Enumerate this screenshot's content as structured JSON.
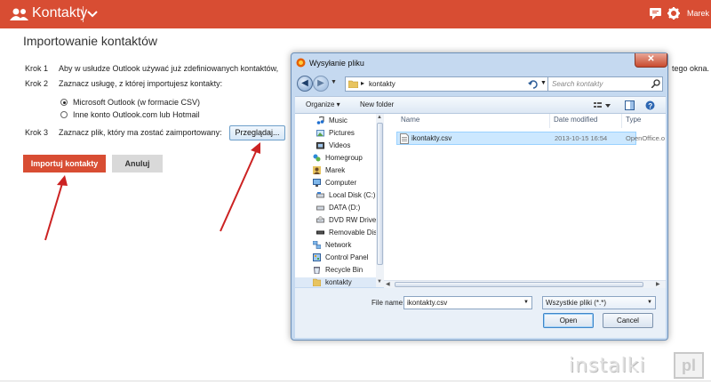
{
  "header": {
    "app_title": "Kontakty",
    "user_name": "Marek"
  },
  "page": {
    "title": "Importowanie kontaktów",
    "step1_label": "Krok 1",
    "step1_text": "Aby w usłudze Outlook używać już zdefiniowanych kontaktów,",
    "step1_tail": "tego okna.",
    "step2_label": "Krok 2",
    "step2_text": "Zaznacz usługę, z której importujesz kontakty:",
    "options": [
      {
        "label": "Microsoft Outlook (w formacie CSV)",
        "selected": true
      },
      {
        "label": "Inne konto Outlook.com lub Hotmail",
        "selected": false
      }
    ],
    "step3_label": "Krok 3",
    "step3_text": "Zaznacz plik, który ma zostać zaimportowany:",
    "browse_label": "Przeglądaj...",
    "import_label": "Importuj kontakty",
    "cancel_label": "Anuluj"
  },
  "dialog": {
    "title": "Wysyłanie pliku",
    "breadcrumb": "kontakty",
    "search_placeholder": "Search kontakty",
    "organize_label": "Organize ▾",
    "new_folder_label": "New folder",
    "nav_items": [
      {
        "label": "Music",
        "icon": "music-icon"
      },
      {
        "label": "Pictures",
        "icon": "pictures-icon"
      },
      {
        "label": "Videos",
        "icon": "videos-icon"
      },
      {
        "label": "Homegroup",
        "icon": "homegroup-icon"
      },
      {
        "label": "Marek",
        "icon": "user-icon"
      },
      {
        "label": "Computer",
        "icon": "computer-icon"
      },
      {
        "label": "Local Disk (C:)",
        "icon": "disk-icon"
      },
      {
        "label": "DATA (D:)",
        "icon": "disk-icon"
      },
      {
        "label": "DVD RW Drive (",
        "icon": "dvd-icon"
      },
      {
        "label": "Removable Dis",
        "icon": "removable-icon"
      },
      {
        "label": "Network",
        "icon": "network-icon"
      },
      {
        "label": "Control Panel",
        "icon": "control-panel-icon"
      },
      {
        "label": "Recycle Bin",
        "icon": "recycle-bin-icon"
      },
      {
        "label": "kontakty",
        "icon": "folder-icon"
      }
    ],
    "columns": [
      "Name",
      "Date modified",
      "Type"
    ],
    "files": [
      {
        "name": "ikontakty.csv",
        "date": "2013-10-15 16:54",
        "type": "OpenOffice.o"
      }
    ],
    "file_name_label": "File name:",
    "file_name_value": "ikontakty.csv",
    "filter_value": "Wszystkie pliki (*.*)",
    "open_label": "Open",
    "cancel_label": "Cancel"
  },
  "watermark": {
    "text": "instalki",
    "logo": "pl"
  },
  "colors": {
    "accent": "#d84d33",
    "arrow": "#cc2222"
  }
}
